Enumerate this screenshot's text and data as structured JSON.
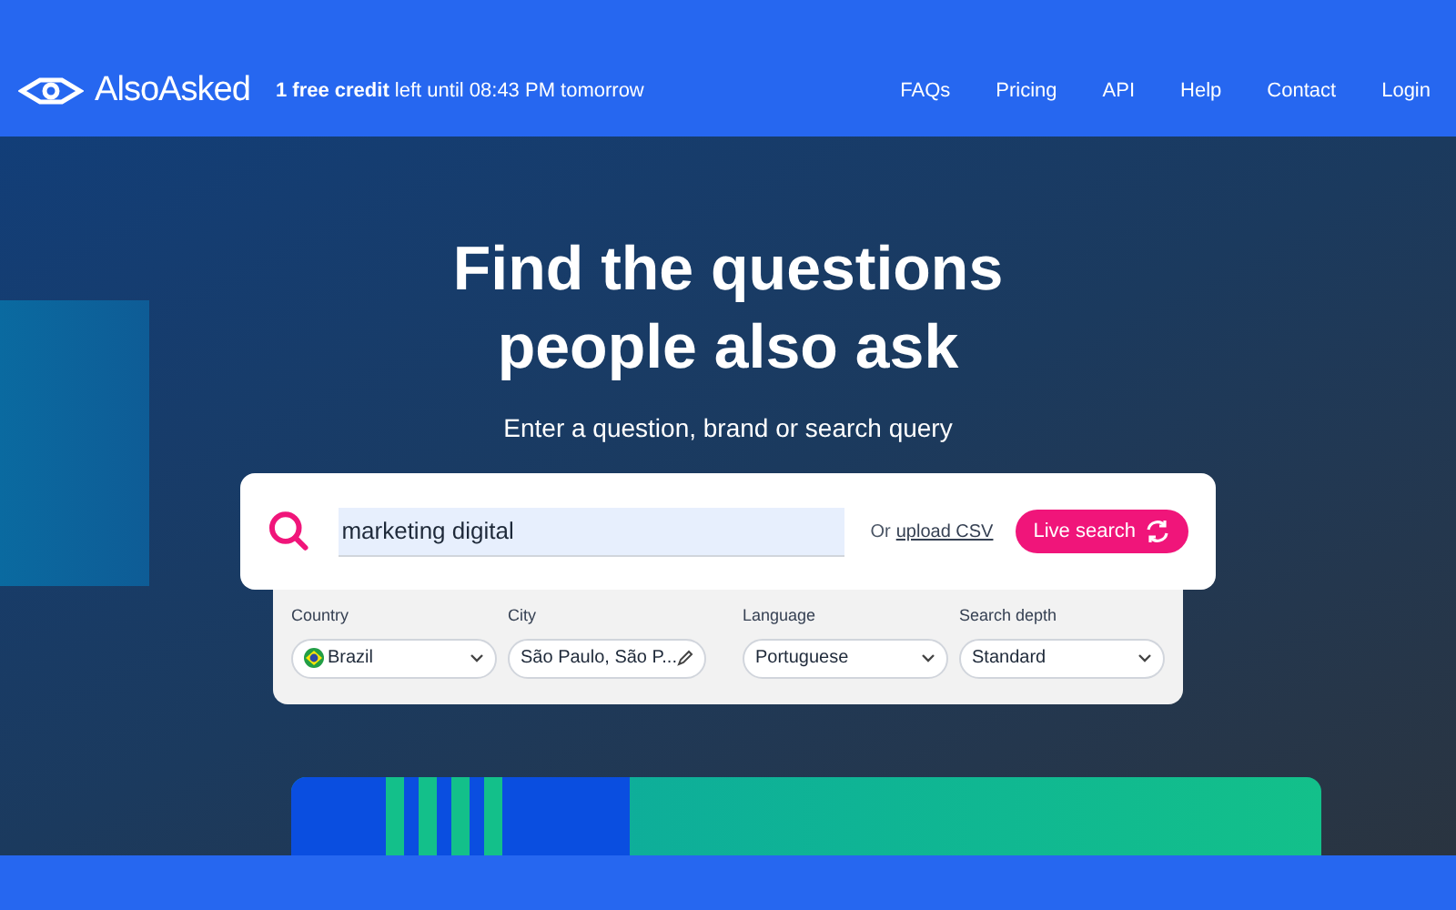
{
  "header": {
    "logo": "AlsoAsked",
    "credit": "**1 free credit** left until 08:43 PM tomorrow",
    "nav": [
      "FAQs",
      "Pricing",
      "API",
      "Help",
      "Contact",
      "Login"
    ]
  },
  "hero": {
    "title_lines": [
      "Find the questions",
      "people also ask"
    ],
    "subtitle": "Enter a question, brand or search query"
  },
  "search": {
    "value": "marketing digital",
    "upload_prefix": "Or",
    "upload_link": "upload CSV",
    "button": "Live search"
  },
  "filters": [
    [
      {
        "label": "Country",
        "value": "Brazil",
        "kind": "select",
        "flag": true
      },
      {
        "label": "City",
        "value": "São Paulo, São P...",
        "kind": "edit"
      }
    ],
    [
      {
        "label": "Language",
        "value": "Portuguese",
        "kind": "select"
      },
      {
        "label": "Search depth",
        "value": "Standard",
        "kind": "select"
      }
    ]
  ]
}
